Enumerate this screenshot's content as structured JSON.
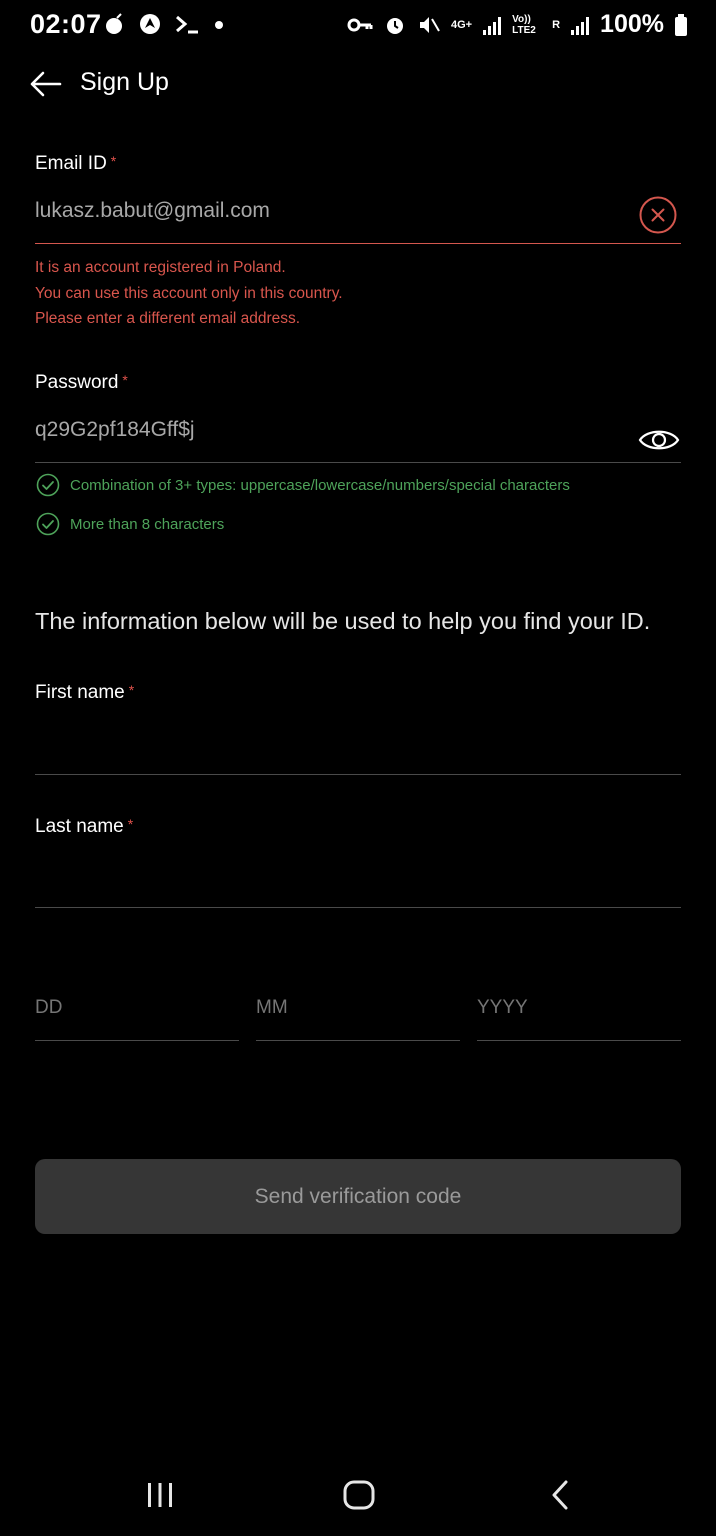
{
  "status_bar": {
    "time": "02:07",
    "battery": "100%",
    "network_label": "4G+",
    "volte_label": "Vo)) LTE2",
    "roaming_label": "R"
  },
  "header": {
    "title": "Sign Up"
  },
  "email": {
    "label": "Email ID",
    "required_mark": "*",
    "value": "lukasz.babut@gmail.com",
    "errors": [
      "It is an account registered in Poland.",
      "You can use this account only in this country.",
      "Please enter a different email address."
    ]
  },
  "password": {
    "label": "Password",
    "required_mark": "*",
    "value": "q29G2pf184Gff$j",
    "rules": [
      "Combination of 3+ types: uppercase/lowercase/numbers/special characters",
      "More than 8 characters"
    ]
  },
  "info_text": "The information below will be used to help you find your ID.",
  "first_name": {
    "label": "First name",
    "required_mark": "*",
    "value": ""
  },
  "last_name": {
    "label": "Last name",
    "required_mark": "*",
    "value": ""
  },
  "dob": {
    "day_placeholder": "DD",
    "month_placeholder": "MM",
    "year_placeholder": "YYYY"
  },
  "send_button": "Send verification code",
  "colors": {
    "error": "#d9564d",
    "success": "#4ea35a",
    "button_bg": "#363636"
  }
}
